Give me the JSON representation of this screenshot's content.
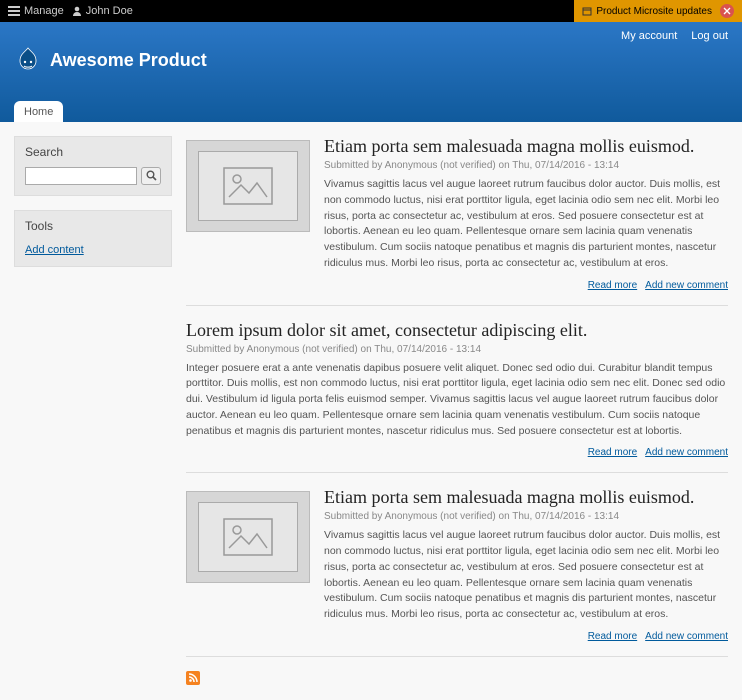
{
  "toolbar": {
    "manage": "Manage",
    "user": "John Doe",
    "update_label": "Product Microsite updates"
  },
  "header": {
    "links": {
      "account": "My account",
      "logout": "Log out"
    },
    "site_name": "Awesome Product",
    "tabs": {
      "home": "Home"
    }
  },
  "sidebar": {
    "search_title": "Search",
    "search_placeholder": "",
    "tools_title": "Tools",
    "add_content": "Add content"
  },
  "articles": [
    {
      "title": "Etiam porta sem malesuada magna mollis euismod.",
      "meta": "Submitted by Anonymous (not verified) on Thu, 07/14/2016 - 13:14",
      "body": "Vivamus sagittis lacus vel augue laoreet rutrum faucibus dolor auctor. Duis mollis, est non commodo luctus, nisi erat porttitor ligula, eget lacinia odio sem nec elit. Morbi leo risus, porta ac consectetur ac, vestibulum at eros. Sed posuere consectetur est at lobortis. Aenean eu leo quam. Pellentesque ornare sem lacinia quam venenatis vestibulum. Cum sociis natoque penatibus et magnis dis parturient montes, nascetur ridiculus mus. Morbi leo risus, porta ac consectetur ac, vestibulum at eros.",
      "has_image": true
    },
    {
      "title": "Lorem ipsum dolor sit amet, consectetur adipiscing elit.",
      "meta": "Submitted by Anonymous (not verified) on Thu, 07/14/2016 - 13:14",
      "body": "Integer posuere erat a ante venenatis dapibus posuere velit aliquet. Donec sed odio dui. Curabitur blandit tempus porttitor. Duis mollis, est non commodo luctus, nisi erat porttitor ligula, eget lacinia odio sem nec elit. Donec sed odio dui. Vestibulum id ligula porta felis euismod semper. Vivamus sagittis lacus vel augue laoreet rutrum faucibus dolor auctor. Aenean eu leo quam. Pellentesque ornare sem lacinia quam venenatis vestibulum. Cum sociis natoque penatibus et magnis dis parturient montes, nascetur ridiculus mus. Sed posuere consectetur est at lobortis.",
      "has_image": false
    },
    {
      "title": "Etiam porta sem malesuada magna mollis euismod.",
      "meta": "Submitted by Anonymous (not verified) on Thu, 07/14/2016 - 13:14",
      "body": "Vivamus sagittis lacus vel augue laoreet rutrum faucibus dolor auctor. Duis mollis, est non commodo luctus, nisi erat porttitor ligula, eget lacinia odio sem nec elit. Morbi leo risus, porta ac consectetur ac, vestibulum at eros. Sed posuere consectetur est at lobortis. Aenean eu leo quam. Pellentesque ornare sem lacinia quam venenatis vestibulum. Cum sociis natoque penatibus et magnis dis parturient montes, nascetur ridiculus mus. Morbi leo risus, porta ac consectetur ac, vestibulum at eros.",
      "has_image": true
    }
  ],
  "links": {
    "read_more": "Read more",
    "add_comment": "Add new comment"
  }
}
